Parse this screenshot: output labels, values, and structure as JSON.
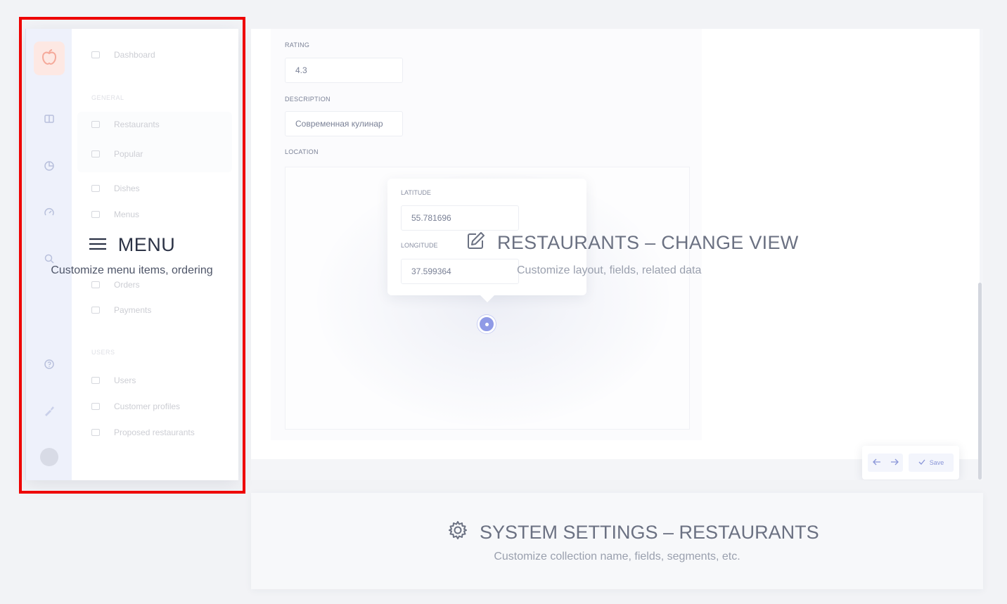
{
  "menu_panel": {
    "title": "MENU",
    "subtitle": "Customize menu items, ordering",
    "nav": {
      "dashboard": "Dashboard",
      "section_collections": "GENERAL",
      "restaurants": "Restaurants",
      "popular": "Popular",
      "dishes": "Dishes",
      "menus": "Menus",
      "orders": "Orders",
      "payments": "Payments",
      "section_users": "USERS",
      "users": "Users",
      "customer_profiles": "Customer profiles",
      "proposed_restaurants": "Proposed restaurants"
    }
  },
  "main_panel": {
    "title": "RESTAURANTS – CHANGE VIEW",
    "subtitle": "Customize layout, fields, related data",
    "form": {
      "rating_label": "RATING",
      "rating_value": "4.3",
      "description_label": "DESCRIPTION",
      "description_value": "Современная кулинар",
      "location_label": "LOCATION",
      "latitude_label": "LATITUDE",
      "latitude_value": "55.781696",
      "longitude_label": "LONGITUDE",
      "longitude_value": "37.599364"
    },
    "actions": {
      "save_label": "Save"
    }
  },
  "settings_panel": {
    "title": "SYSTEM SETTINGS – RESTAURANTS",
    "subtitle": "Customize collection name, fields, segments, etc."
  },
  "colors": {
    "highlight": "#ee0000",
    "accent": "#8f9ae6",
    "logo_bg": "#fde8e3",
    "rail_bg": "#eef1fb"
  },
  "icons": {
    "menu": "hamburger-icon",
    "edit": "edit-icon",
    "settings": "gear-icon",
    "logo": "apple-icon",
    "save": "check-icon",
    "undo": "undo-icon",
    "redo": "redo-icon"
  }
}
